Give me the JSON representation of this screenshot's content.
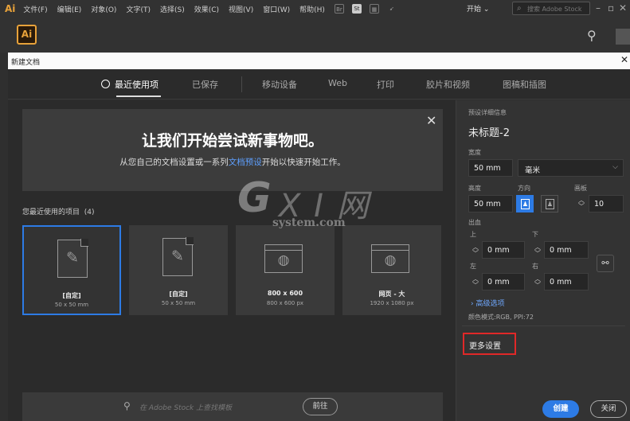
{
  "menubar": {
    "app_icon": "Ai",
    "items": [
      "文件(F)",
      "编辑(E)",
      "对象(O)",
      "文字(T)",
      "选择(S)",
      "效果(C)",
      "视图(V)",
      "窗口(W)",
      "帮助(H)"
    ],
    "bridge_icon": "Br",
    "stock_icon": "St",
    "workspace": "开始",
    "stock_search_placeholder": "搜索 Adobe Stock"
  },
  "app": {
    "logo": "Ai"
  },
  "dialog": {
    "title": "新建文档",
    "tabs": [
      "最近使用项",
      "已保存",
      "移动设备",
      "Web",
      "打印",
      "胶片和视频",
      "图稿和插图"
    ],
    "active_tab": "最近使用项",
    "hero_title": "让我们开始尝试新事物吧。",
    "hero_sub_before": "从您自己的文档设置或一系列",
    "hero_sub_link": "文档预设",
    "hero_sub_after": "开始以快速开始工作。",
    "recent_label": "您最近使用的项目",
    "recent_count": "(4)",
    "recent_items": [
      {
        "name": "[自定]",
        "size": "50 x 50 mm",
        "icon": "document-pen-icon",
        "selected": true
      },
      {
        "name": "[自定]",
        "size": "50 x 50 mm",
        "icon": "document-pen-icon",
        "selected": false
      },
      {
        "name": "800 x 600",
        "size": "800 x 600 px",
        "icon": "web-page-icon",
        "selected": false
      },
      {
        "name": "网页 - 大",
        "size": "1920 x 1080 px",
        "icon": "web-page-icon",
        "selected": false
      }
    ],
    "bottom_search_placeholder": "在 Adobe Stock 上查找模板",
    "go_label": "前往"
  },
  "preset": {
    "section_label": "预设详细信息",
    "doc_name": "未标题-2",
    "width_label": "宽度",
    "width_value": "50 mm",
    "unit": "毫米",
    "height_label": "高度",
    "height_value": "50 mm",
    "orientation_label": "方向",
    "artboards_label": "画板",
    "artboards_value": "10",
    "bleed_label": "出血",
    "top_label": "上",
    "bottom_label": "下",
    "left_label": "左",
    "right_label": "右",
    "bleed_top": "0 mm",
    "bleed_bottom": "0 mm",
    "bleed_left": "0 mm",
    "bleed_right": "0 mm",
    "advanced_label": "高级选项",
    "color_mode": "颜色模式:RGB, PPI:72",
    "more_settings": "更多设置",
    "create_label": "创建",
    "close_label": "关闭"
  },
  "watermark": {
    "g": "G",
    "xi": "X I 网",
    "sub": "system.com"
  },
  "colors": {
    "accent": "#2d7be5",
    "highlight": "#e02828",
    "ai_orange": "#e8a23a"
  }
}
